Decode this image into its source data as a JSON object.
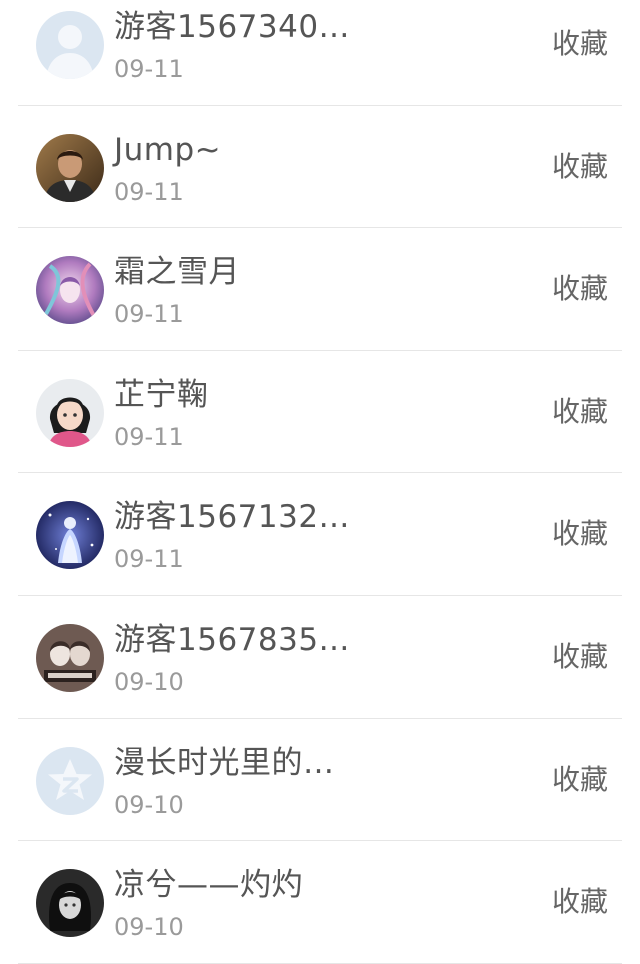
{
  "feed": {
    "items": [
      {
        "name": "游客1567340…",
        "date": "09-11",
        "action": "收藏",
        "avatar": "default-person-icon"
      },
      {
        "name": "Jump~",
        "date": "09-11",
        "action": "收藏",
        "avatar": "man-portrait-photo"
      },
      {
        "name": "霜之雪月",
        "date": "09-11",
        "action": "收藏",
        "avatar": "anime-art-photo"
      },
      {
        "name": "芷宁鞠",
        "date": "09-11",
        "action": "收藏",
        "avatar": "girl-portrait-photo"
      },
      {
        "name": "游客1567132…",
        "date": "09-11",
        "action": "收藏",
        "avatar": "anime-princess-photo"
      },
      {
        "name": "游客1567835…",
        "date": "09-10",
        "action": "收藏",
        "avatar": "sketch-couple-photo"
      },
      {
        "name": "漫长时光里的…",
        "date": "09-10",
        "action": "收藏",
        "avatar": "qzone-star-icon"
      },
      {
        "name": "凉兮——灼灼",
        "date": "09-10",
        "action": "收藏",
        "avatar": "dark-portrait-photo"
      }
    ]
  },
  "colors": {
    "name_text": "#555555",
    "date_text": "#9a9a9a",
    "action_text": "#666666",
    "divider": "#e6e6e6",
    "default_avatar_bg": "#dbe6f1"
  }
}
